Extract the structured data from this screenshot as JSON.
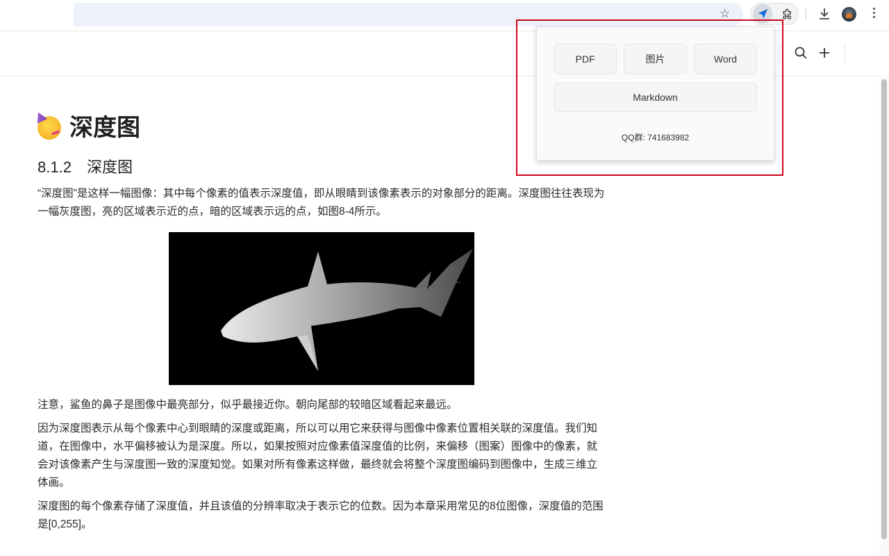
{
  "popup": {
    "buttons": [
      "PDF",
      "图片",
      "Word"
    ],
    "markdown_button": "Markdown",
    "qq_text": "QQ群: 741683982"
  },
  "article": {
    "title": "深度图",
    "section_number": "8.1.2",
    "section_title": "深度图",
    "para1": "“深度图”是这样一幅图像：其中每个像素的值表示深度值，即从眼睛到该像素表示的对象部分的距离。深度图往往表现为一幅灰度图，亮的区域表示近的点，暗的区域表示远的点，如图8-4所示。",
    "para2": "注意，鲨鱼的鼻子是图像中最亮部分，似乎最接近你。朝向尾部的较暗区域看起来最远。",
    "para3": "因为深度图表示从每个像素中心到眼睛的深度或距离，所以可以用它来获得与图像中像素位置相关联的深度值。我们知道，在图像中，水平偏移被认为是深度。所以，如果按照对应像素值深度值的比例，来偏移（图案）图像中的像素，就会对该像素产生与深度图一致的深度知觉。如果对所有像素这样做，最终就会将整个深度图编码到图像中，生成三维立体画。",
    "para4": "深度图的每个像素存储了深度值，并且该值的分辨率取决于表示它的位数。因为本章采用常见的8位图像，深度值的范围是[0,255]。"
  },
  "icons": {
    "bookmark": "star-icon",
    "extension_active": "send-icon",
    "extensions": "puzzle-icon",
    "download": "download-icon",
    "profile": "avatar",
    "menu": "more-vert-icon",
    "header_search": "search-icon",
    "header_add": "plus-icon"
  },
  "colors": {
    "highlight": "#d0021b",
    "extension_accent": "#1a73e8",
    "omnibox": "#edf2fa"
  }
}
